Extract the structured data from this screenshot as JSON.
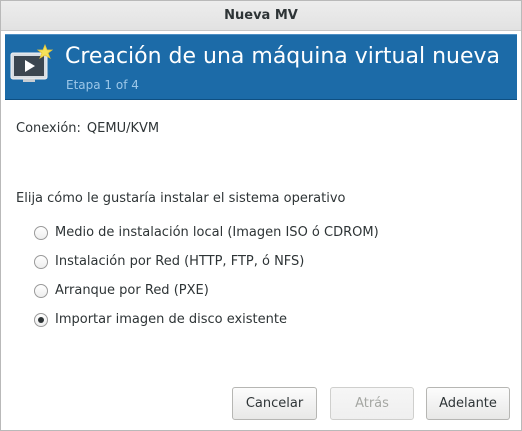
{
  "window": {
    "title": "Nueva MV"
  },
  "banner": {
    "title": "Creación de una máquina virtual nueva",
    "step": "Etapa 1 of 4",
    "icon": "virtual-machine-new-icon",
    "accent_color": "#1c6ba8"
  },
  "connection": {
    "label": "Conexión:",
    "value": "QEMU/KVM"
  },
  "install": {
    "question": "Elija cómo le gustaría instalar el sistema operativo",
    "options": [
      {
        "label": "Medio de instalación local (Imagen ISO ó CDROM)",
        "selected": false
      },
      {
        "label": "Instalación por Red (HTTP, FTP, ó NFS)",
        "selected": false
      },
      {
        "label": "Arranque por Red (PXE)",
        "selected": false
      },
      {
        "label": "Importar imagen de disco existente",
        "selected": true
      }
    ]
  },
  "buttons": {
    "cancel": "Cancelar",
    "back": "Atrás",
    "back_enabled": false,
    "forward": "Adelante"
  }
}
